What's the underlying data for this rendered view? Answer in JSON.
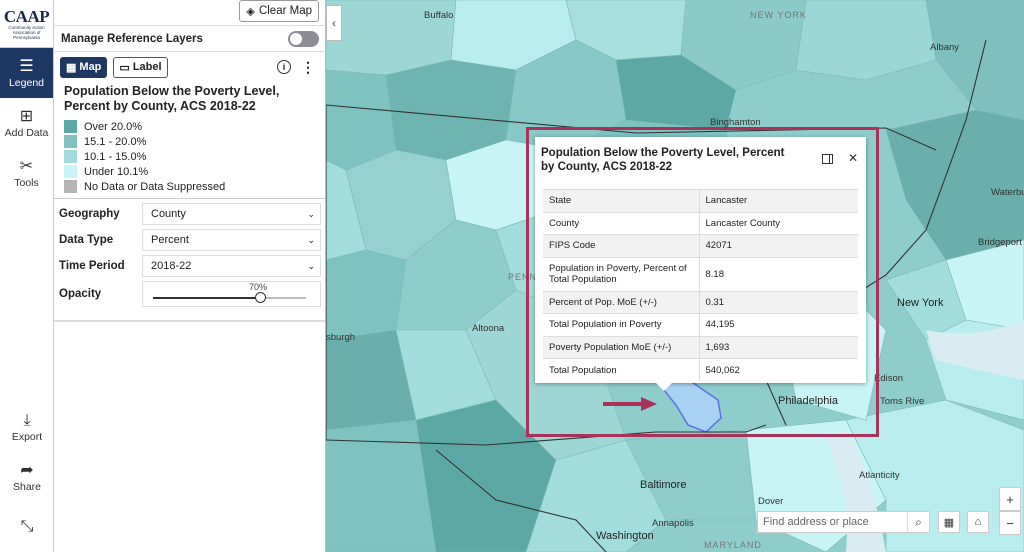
{
  "brand": {
    "logo_text": "CAAP",
    "logo_subtitle": "Community Action Association of Pennsylvania"
  },
  "rail": {
    "items": [
      {
        "label": "Legend",
        "icon": "list-icon",
        "active": true
      },
      {
        "label": "Add Data",
        "icon": "add-data-icon"
      },
      {
        "label": "Tools",
        "icon": "tools-icon"
      }
    ],
    "bottom": [
      {
        "label": "Export",
        "icon": "download-icon"
      },
      {
        "label": "Share",
        "icon": "share-icon"
      },
      {
        "label": "",
        "icon": "collapse-arrows-icon"
      }
    ]
  },
  "panel": {
    "clear_map": "Clear Map",
    "manage_layers": "Manage Reference Layers",
    "mode_map": "Map",
    "mode_label": "Label",
    "legend_title": "Population Below the Poverty Level, Percent by County, ACS 2018-22",
    "legend": [
      {
        "label": "Over 20.0%",
        "color": "#5ca8a6"
      },
      {
        "label": "15.1 - 20.0%",
        "color": "#7ec2c1"
      },
      {
        "label": "10.1 - 15.0%",
        "color": "#a3dcdc"
      },
      {
        "label": "Under 10.1%",
        "color": "#c8f4f6"
      },
      {
        "label": "No Data or Data Suppressed",
        "color": "#b5b5b5"
      }
    ],
    "controls": {
      "geography_label": "Geography",
      "geography_value": "County",
      "datatype_label": "Data Type",
      "datatype_value": "Percent",
      "period_label": "Time Period",
      "period_value": "2018-22",
      "opacity_label": "Opacity",
      "opacity_value": "70%",
      "opacity_fraction": 0.7
    }
  },
  "map": {
    "cities": {
      "buffalo": "Buffalo",
      "newyork_state": "NEW YORK",
      "albany": "Albany",
      "binghamton": "Binghamton",
      "waterbury": "Waterbu",
      "bridgeport": "Bridgeport",
      "newyork": "New York",
      "altoona": "Altoona",
      "pittsburgh": "sburgh",
      "philadelphia": "Philadelphia",
      "baltimore": "Baltimore",
      "dover": "Dover",
      "annapolis": "Annapolis",
      "washington": "Washington",
      "atlantic_city": "Atlanticity",
      "toms_river": "Toms Rive",
      "edison": "Edison",
      "maryland": "MARYLAND",
      "penn": "PENN"
    },
    "search_placeholder": "Find address or place"
  },
  "popup": {
    "title": "Population Below the Poverty Level, Percent by County, ACS 2018-22",
    "rows": [
      {
        "field": "State",
        "value": "Lancaster"
      },
      {
        "field": "County",
        "value": "Lancaster County"
      },
      {
        "field": "FIPS Code",
        "value": "42071"
      },
      {
        "field": "Population in Poverty, Percent of Total Population",
        "value": "8.18"
      },
      {
        "field": "Percent of Pop. MoE (+/-)",
        "value": "0.31"
      },
      {
        "field": "Total Population in Poverty",
        "value": "44,195"
      },
      {
        "field": "Poverty Population MoE (+/-)",
        "value": "1,693"
      },
      {
        "field": "Total Population",
        "value": "540,062"
      }
    ]
  },
  "colors": {
    "accent": "#1f3863",
    "highlight": "#a8325a"
  }
}
